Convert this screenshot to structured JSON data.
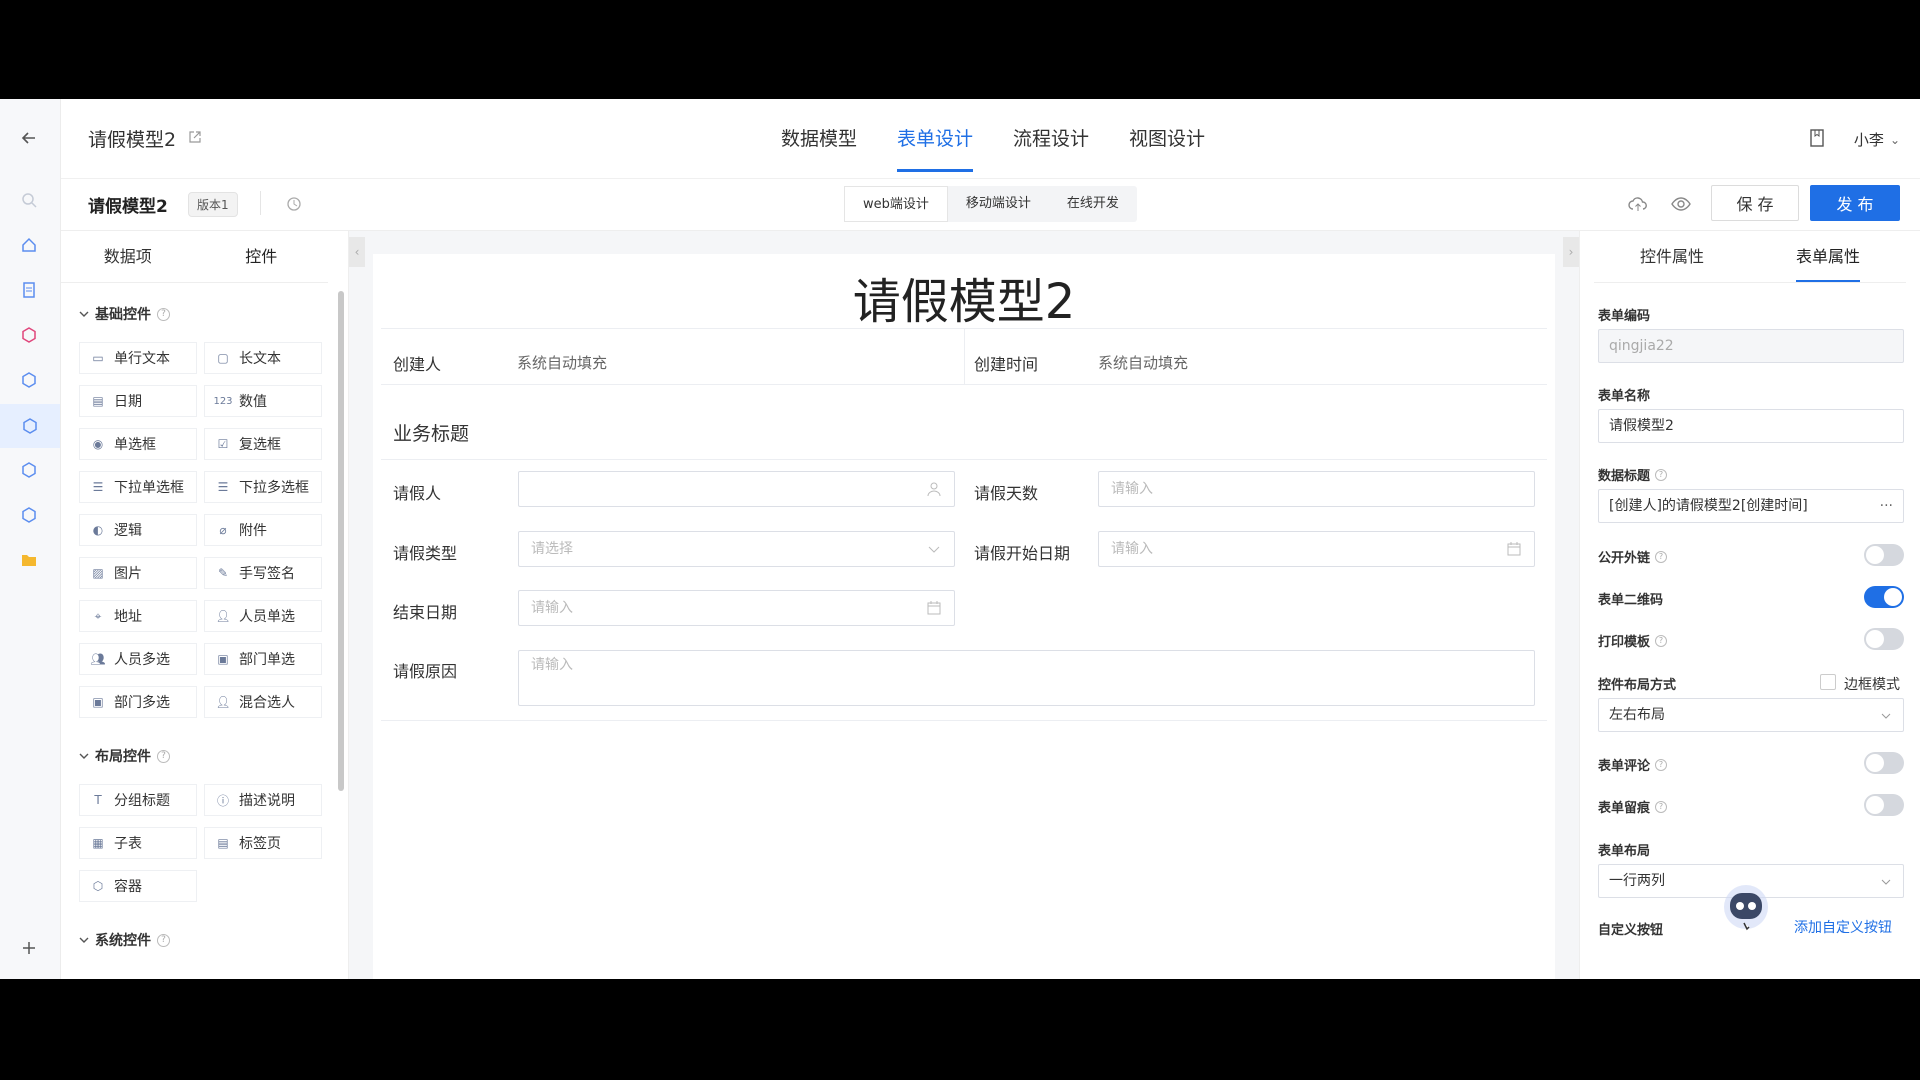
{
  "header": {
    "title": "请假模型2",
    "tabs": [
      {
        "label": "数据模型"
      },
      {
        "label": "表单设计"
      },
      {
        "label": "流程设计"
      },
      {
        "label": "视图设计"
      }
    ],
    "user": "小李"
  },
  "subheader": {
    "name": "请假模型2",
    "version": "版本1",
    "modes": [
      "web端设计",
      "移动端设计",
      "在线开发"
    ],
    "save_label": "保 存",
    "publish_label": "发 布"
  },
  "left_panel": {
    "tabs": [
      "数据项",
      "控件"
    ],
    "groups": [
      {
        "title": "基础控件"
      },
      {
        "title": "布局控件"
      },
      {
        "title": "系统控件"
      }
    ],
    "basic": [
      "单行文本",
      "长文本",
      "日期",
      "数值",
      "单选框",
      "复选框",
      "下拉单选框",
      "下拉多选框",
      "逻辑",
      "附件",
      "图片",
      "手写签名",
      "地址",
      "人员单选",
      "人员多选",
      "部门单选",
      "部门多选",
      "混合选人"
    ],
    "layout": [
      "分组标题",
      "描述说明",
      "子表",
      "标签页",
      "容器"
    ]
  },
  "canvas": {
    "form_title": "请假模型2",
    "creator_label": "创建人",
    "creator_value": "系统自动填充",
    "created_time_label": "创建时间",
    "created_time_value": "系统自动填充",
    "section_title": "业务标题",
    "fields": {
      "applicant": "请假人",
      "days": "请假天数",
      "days_ph": "请输入",
      "type": "请假类型",
      "type_ph": "请选择",
      "start": "请假开始日期",
      "start_ph": "请输入",
      "end": "结束日期",
      "end_ph": "请输入",
      "reason": "请假原因",
      "reason_ph": "请输入"
    }
  },
  "right_panel": {
    "tabs": [
      "控件属性",
      "表单属性"
    ],
    "form_code_label": "表单编码",
    "form_code": "qingjia22",
    "form_name_label": "表单名称",
    "form_name": "请假模型2",
    "data_title_label": "数据标题",
    "data_title": "[创建人]的请假模型2[创建时间]",
    "public_link_label": "公开外链",
    "qr_label": "表单二维码",
    "print_label": "打印模板",
    "layout_mode_label": "控件布局方式",
    "border_mode_label": "边框模式",
    "layout_mode": "左右布局",
    "comment_label": "表单评论",
    "trace_label": "表单留痕",
    "form_layout_label": "表单布局",
    "form_layout": "一行两列",
    "custom_btn_label": "自定义按钮",
    "add_custom_btn": "添加自定义按钮",
    "toggles": {
      "public_link": false,
      "qr": true,
      "print": false,
      "comment": false,
      "trace": false
    }
  },
  "colors": {
    "accent": "#1f6fe5"
  }
}
